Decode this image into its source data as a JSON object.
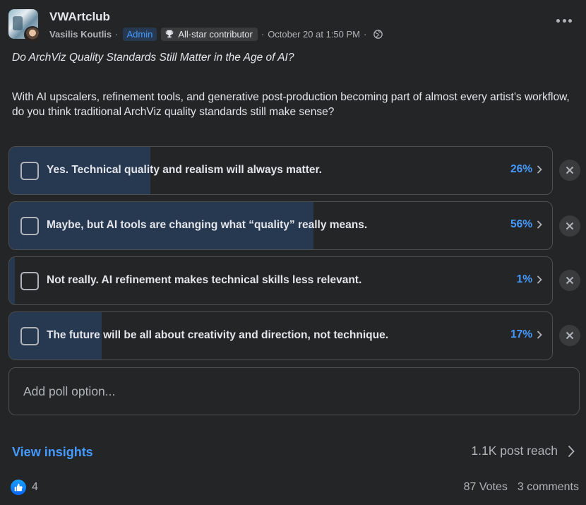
{
  "header": {
    "group_name": "VWArtclub",
    "author": "Vasilis Koutlis",
    "admin_badge": "Admin",
    "allstar_badge": "All-star contributor",
    "timestamp": "October 20 at 1:50 PM",
    "separator": "·",
    "icons": [
      "trophy-icon",
      "globe-icon",
      "more-options-icon"
    ]
  },
  "post": {
    "title": "Do ArchViz Quality Standards Still Matter in the Age of AI?",
    "body": "With AI upscalers, refinement tools, and generative post-production becoming part of almost every artist’s workflow, do you think traditional ArchViz quality standards still make sense?"
  },
  "poll": {
    "options": [
      {
        "label": "Yes. Technical quality and realism will always matter.",
        "percent_label": "26%",
        "fill_fraction": 0.26
      },
      {
        "label": "Maybe, but AI tools are changing what “quality” really means.",
        "percent_label": "56%",
        "fill_fraction": 0.56
      },
      {
        "label": "Not really. AI refinement makes technical skills less relevant.",
        "percent_label": "1%",
        "fill_fraction": 0.01
      },
      {
        "label": "The future will be all about creativity and direction, not technique.",
        "percent_label": "17%",
        "fill_fraction": 0.17
      }
    ],
    "add_option_placeholder": "Add poll option..."
  },
  "insights": {
    "link_label": "View insights",
    "reach_label": "1.1K post reach"
  },
  "footer": {
    "like_count": "4",
    "votes_label": "87 Votes",
    "comments_label": "3 comments"
  },
  "colors": {
    "background": "#242526",
    "accent": "#4599ff",
    "poll_fill": "#263951",
    "text_primary": "#e4e6eb",
    "text_secondary": "#b0b3b8"
  }
}
